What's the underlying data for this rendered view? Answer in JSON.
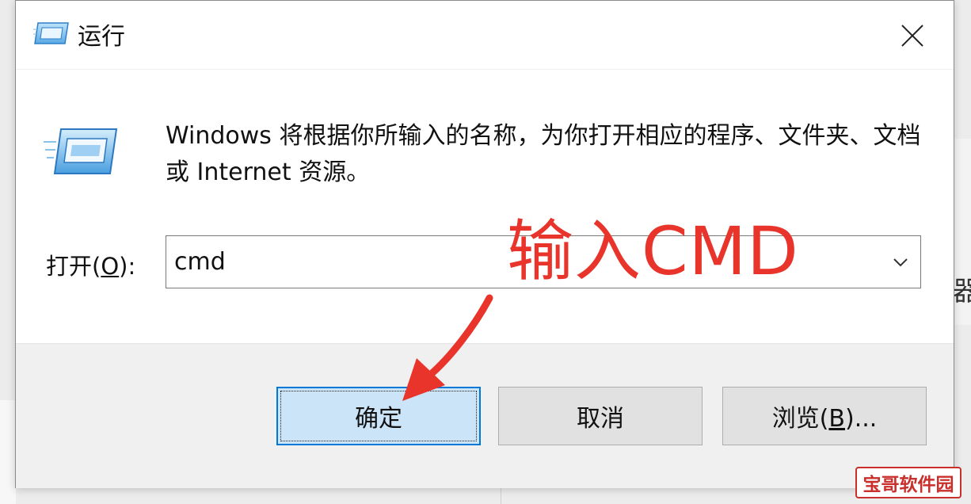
{
  "window": {
    "title": "运行",
    "close_icon": "close-icon"
  },
  "description": "Windows 将根据你所输入的名称，为你打开相应的程序、文件夹、文档或 Internet 资源。",
  "open_field": {
    "label_prefix": "打开(",
    "label_mnemonic": "O",
    "label_suffix": "):",
    "value": "cmd"
  },
  "buttons": {
    "ok": "确定",
    "cancel": "取消",
    "browse_prefix": "浏览(",
    "browse_mnemonic": "B",
    "browse_suffix": ")..."
  },
  "annotation": {
    "text": "输入CMD",
    "color": "#e8342b"
  },
  "watermark": "宝哥软件园",
  "background": {
    "partial_char": "器"
  },
  "colors": {
    "accent": "#0078d7",
    "ok_fill": "#cce4f7",
    "footer": "#f0f0f0"
  }
}
